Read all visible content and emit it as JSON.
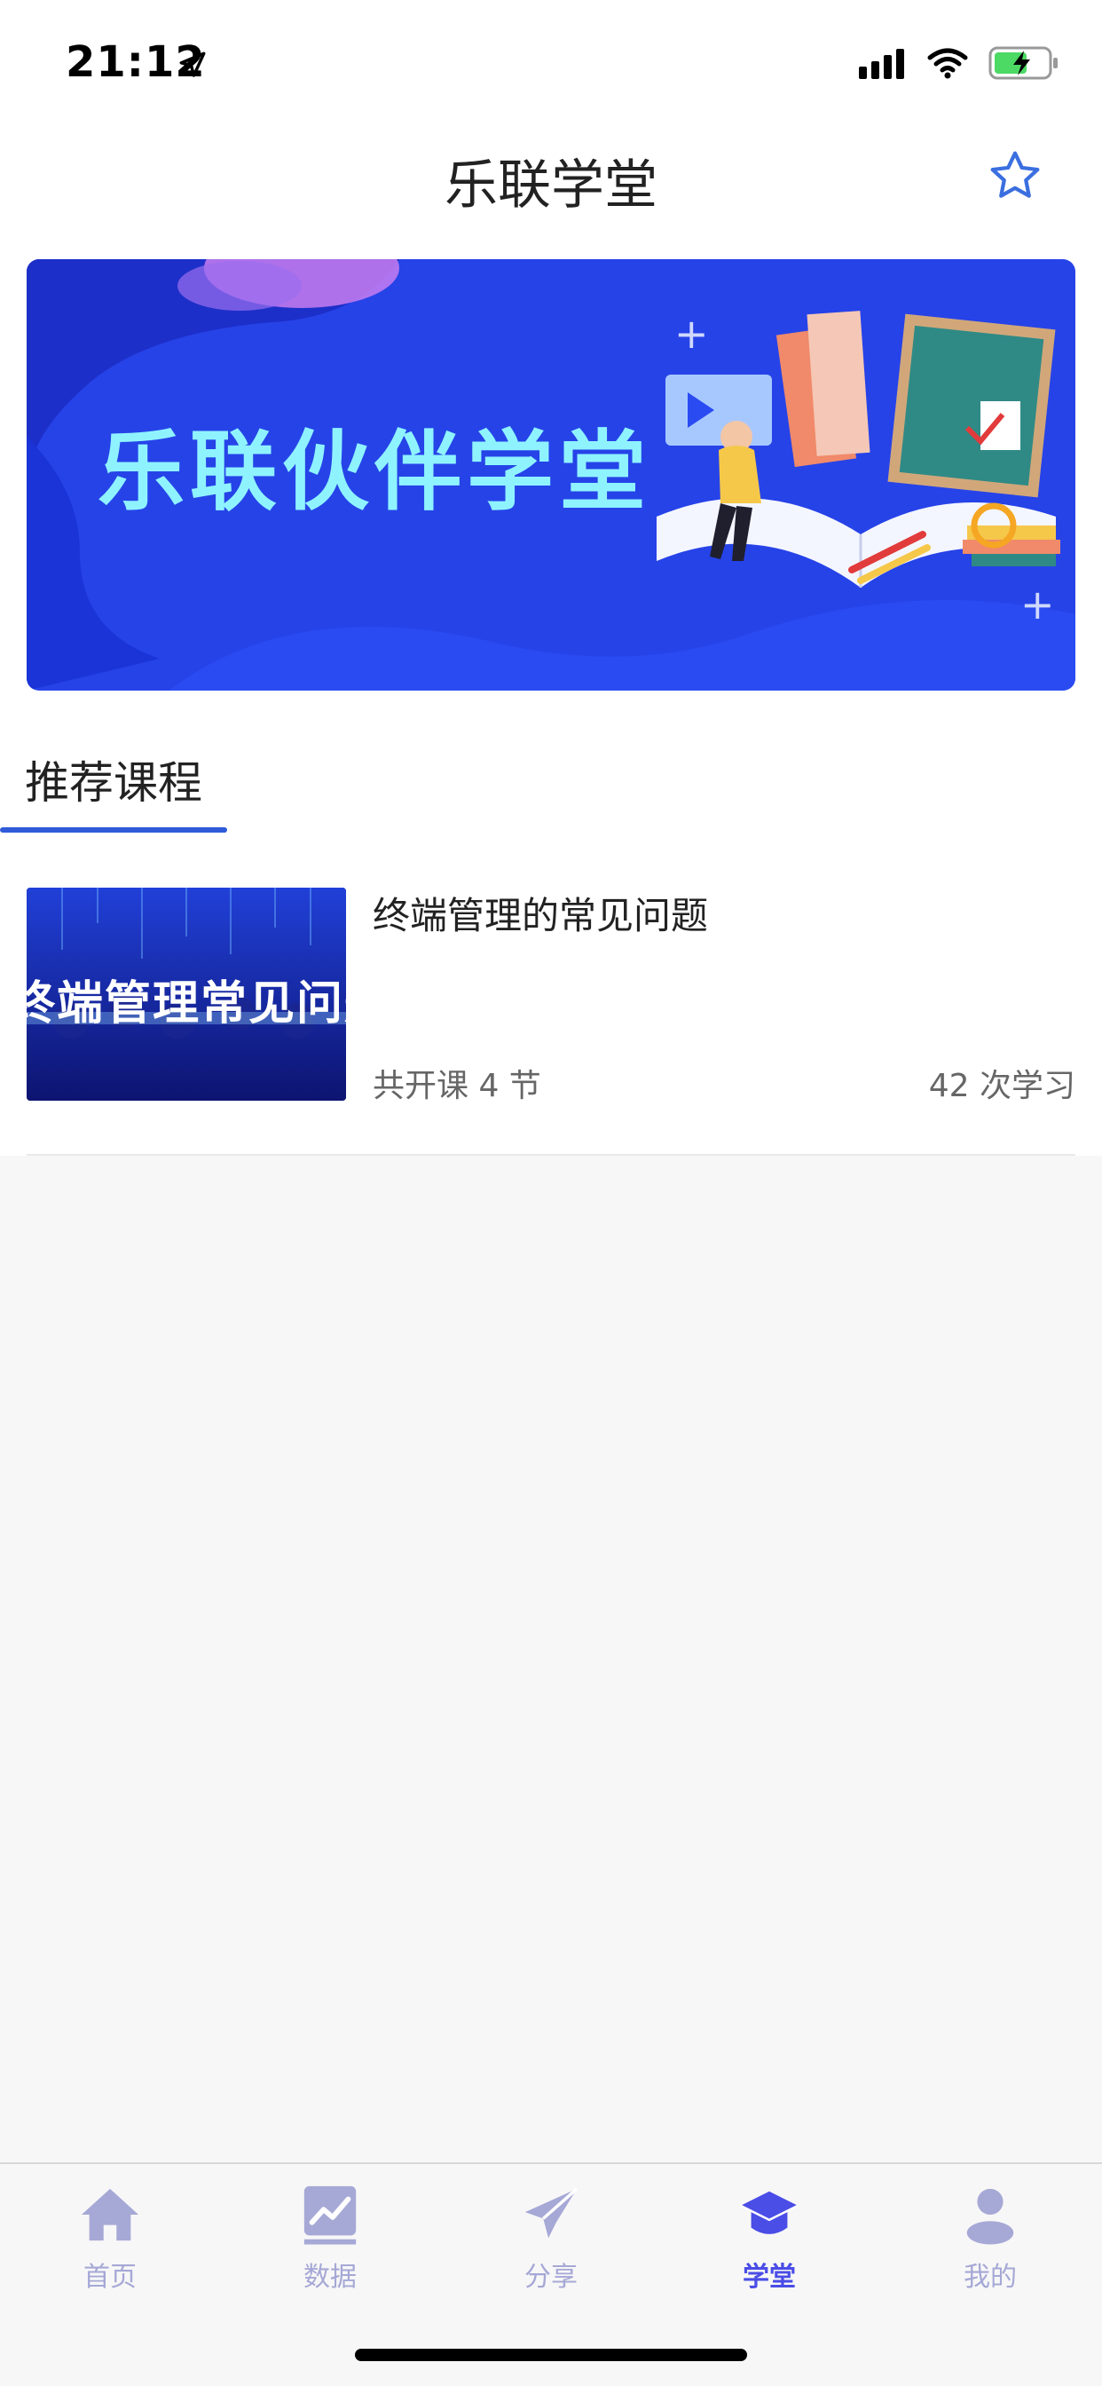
{
  "status_bar": {
    "time": "21:12"
  },
  "nav": {
    "title": "乐联学堂"
  },
  "banner": {
    "title": "乐联伙伴学堂"
  },
  "section": {
    "title": "推荐课程"
  },
  "courses": [
    {
      "thumb_text": "终端管理常见问题",
      "title": "终端管理的常见问题",
      "lessons": "共开课 4 节",
      "views": "42 次学习"
    }
  ],
  "tabs": [
    {
      "label": "首页",
      "icon": "home-icon"
    },
    {
      "label": "数据",
      "icon": "chart-icon"
    },
    {
      "label": "分享",
      "icon": "paper-plane-icon"
    },
    {
      "label": "学堂",
      "icon": "graduation-cap-icon",
      "active": true
    },
    {
      "label": "我的",
      "icon": "user-icon"
    }
  ],
  "colors": {
    "accent": "#4a4de6",
    "tab_inactive": "#a6a8d6",
    "underline": "#2f5bd9",
    "banner_bg": "#2643e8"
  }
}
